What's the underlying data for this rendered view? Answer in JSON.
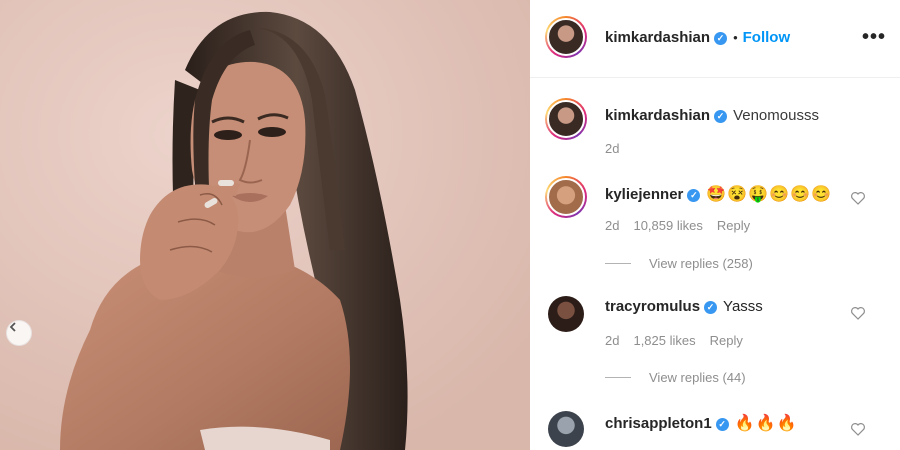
{
  "post": {
    "author": "kimkardashian",
    "follow_label": "Follow",
    "dot": "•",
    "more_label": "•••",
    "caption": "Venomousss",
    "time": "2d"
  },
  "comments": [
    {
      "username": "kyliejenner",
      "text": "🤩😵🤑😊😊😊",
      "time": "2d",
      "likes": "10,859 likes",
      "reply": "Reply",
      "view_replies": "View replies (258)"
    },
    {
      "username": "tracyromulus",
      "text": "Yasss",
      "time": "2d",
      "likes": "1,825 likes",
      "reply": "Reply",
      "view_replies": "View replies (44)"
    },
    {
      "username": "chrisappleton1",
      "text": "🔥🔥🔥"
    }
  ],
  "colors": {
    "link_blue": "#0095f6",
    "verified_blue": "#3897f0",
    "muted_text": "#8e8e8e"
  },
  "icons": {
    "verified": "verified-badge-icon",
    "heart": "heart-outline-icon",
    "more": "more-options-icon",
    "prev": "chevron-left-icon"
  }
}
